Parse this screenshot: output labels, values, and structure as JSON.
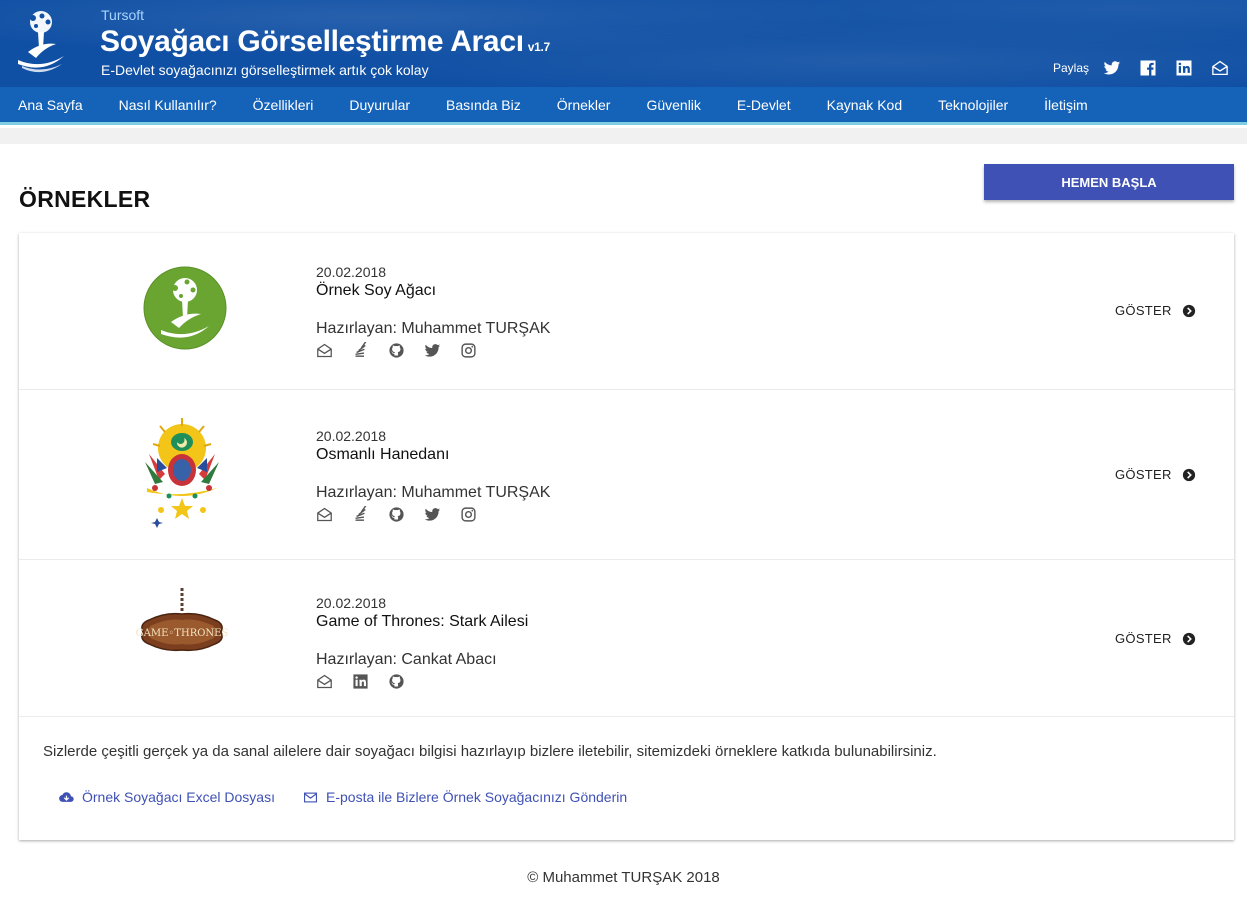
{
  "header": {
    "brand_small": "Tursoft",
    "title": "Soyağacı Görselleştirme Aracı",
    "version": "v1.7",
    "subtitle": "E-Devlet soyağacınızı görselleştirmek artık çok kolay",
    "share_label": "Paylaş",
    "share_icons": [
      "twitter-icon",
      "facebook-icon",
      "linkedin-icon",
      "envelope-icon"
    ]
  },
  "nav": {
    "items": [
      "Ana Sayfa",
      "Nasıl Kullanılır?",
      "Özellikleri",
      "Duyurular",
      "Basında Biz",
      "Örnekler",
      "Güvenlik",
      "E-Devlet",
      "Kaynak Kod",
      "Teknolojiler",
      "İletişim"
    ]
  },
  "page": {
    "title": "ÖRNEKLER",
    "start_button": "HEMEN BAŞLA"
  },
  "examples": [
    {
      "date": "20.02.2018",
      "title": "Örnek Soy Ağacı",
      "author": "Hazırlayan: Muhammet TURŞAK",
      "socials": [
        "envelope-icon",
        "stackoverflow-icon",
        "github-icon",
        "twitter-icon",
        "instagram-icon"
      ],
      "image": "tursoft-tree-logo",
      "action": "GÖSTER"
    },
    {
      "date": "20.02.2018",
      "title": "Osmanlı Hanedanı",
      "author": "Hazırlayan: Muhammet TURŞAK",
      "socials": [
        "envelope-icon",
        "stackoverflow-icon",
        "github-icon",
        "twitter-icon",
        "instagram-icon"
      ],
      "image": "ottoman-coat-of-arms",
      "action": "GÖSTER"
    },
    {
      "date": "20.02.2018",
      "title": "Game of Thrones: Stark Ailesi",
      "author": "Hazırlayan: Cankat Abacı",
      "socials": [
        "envelope-icon",
        "linkedin-icon",
        "github-icon"
      ],
      "image": "game-of-thrones-logo",
      "action": "GÖSTER"
    }
  ],
  "info": {
    "text": "Sizlerde çeşitli gerçek ya da sanal ailelere dair soyağacı bilgisi hazırlayıp bizlere iletebilir, sitemizdeki örneklere katkıda bulunabilirsiniz.",
    "link_excel": "Örnek Soyağacı Excel Dosyası",
    "link_email": "E-posta ile Bizlere Örnek Soyağacınızı Gönderin"
  },
  "footer": {
    "text": "© Muhammet TURŞAK 2018"
  },
  "colors": {
    "header_bg": "#0f4fa4",
    "nav_bg": "#1563b9",
    "accent": "#3f51b5",
    "nav_border": "#7fcde0"
  }
}
